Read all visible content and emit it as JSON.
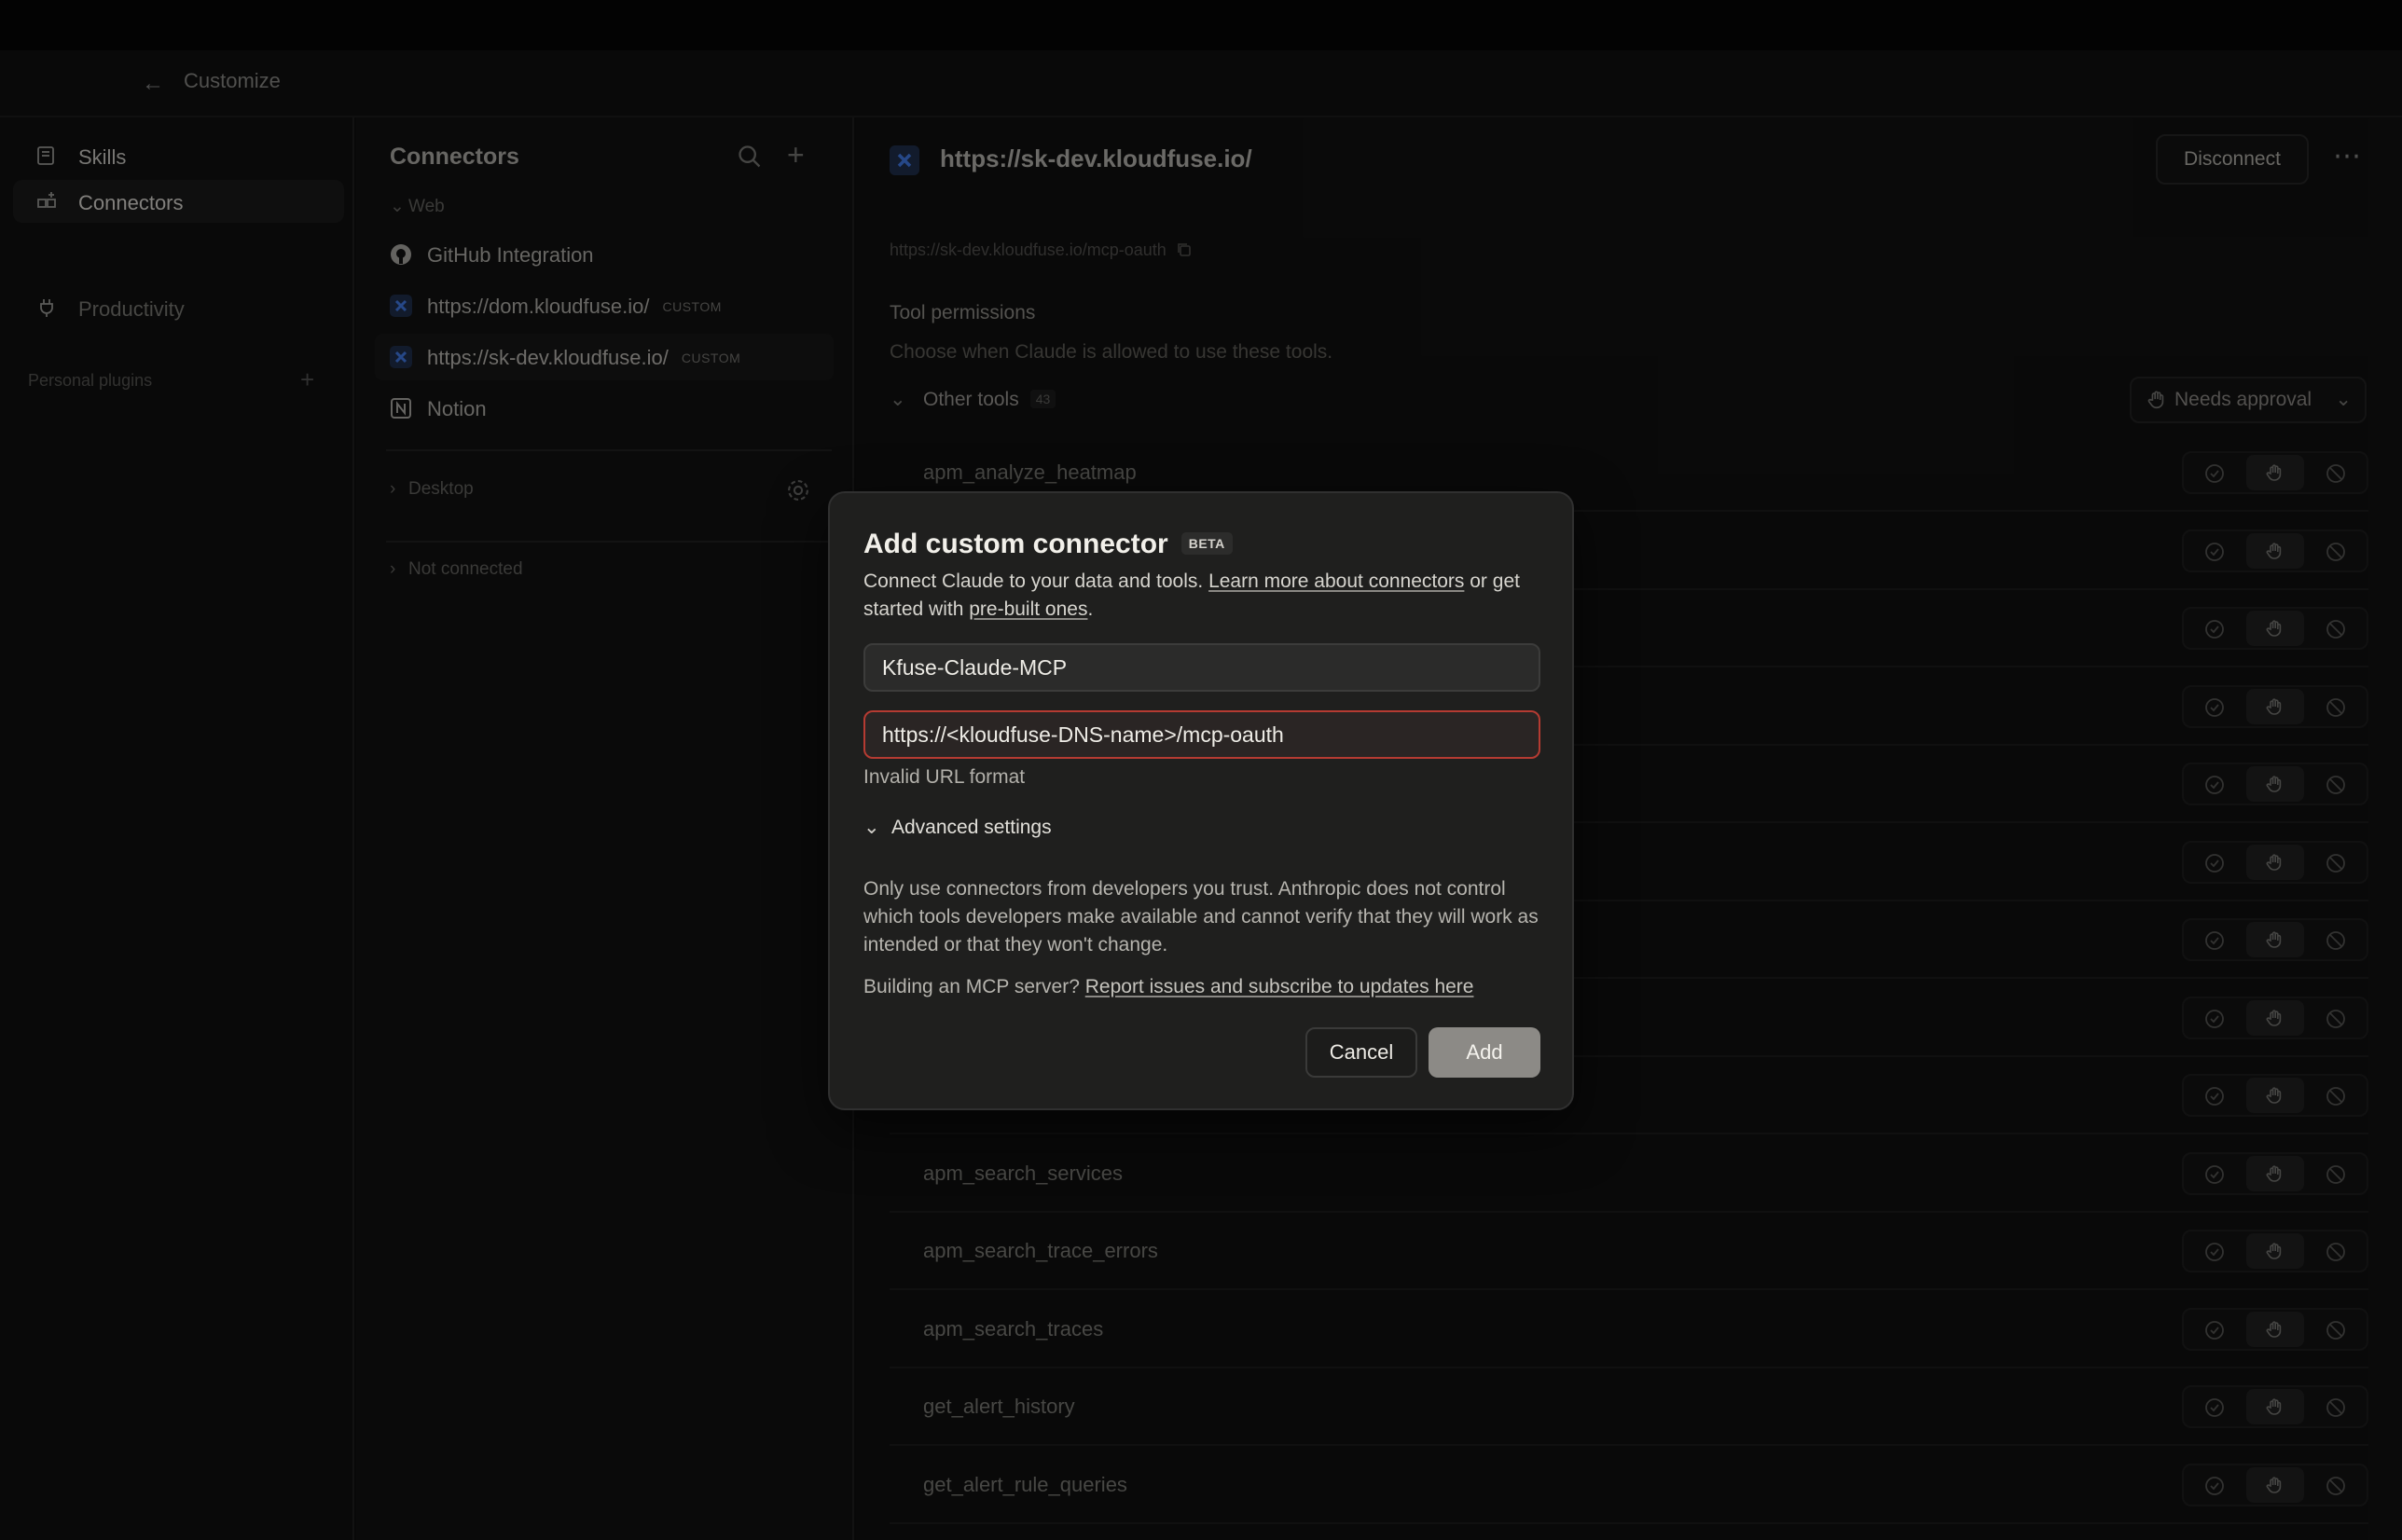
{
  "header": {
    "back_label": "Customize"
  },
  "sidebar": {
    "items": [
      {
        "label": "Skills",
        "icon": "book-icon"
      },
      {
        "label": "Connectors",
        "icon": "grid-plus-icon"
      }
    ],
    "section_title": "Personal plugins",
    "plugins": [
      {
        "label": "Productivity",
        "icon": "plug-icon"
      }
    ]
  },
  "connectors": {
    "title": "Connectors",
    "groups": {
      "web": "Web",
      "desktop": "Desktop",
      "not_connected": "Not connected"
    },
    "items": [
      {
        "name": "GitHub Integration",
        "tag": ""
      },
      {
        "name": "https://dom.kloudfuse.io/",
        "tag": "CUSTOM"
      },
      {
        "name": "https://sk-dev.kloudfuse.io/",
        "tag": "CUSTOM"
      },
      {
        "name": "Notion",
        "tag": ""
      }
    ]
  },
  "main": {
    "title": "https://sk-dev.kloudfuse.io/",
    "disconnect_label": "Disconnect",
    "url": "https://sk-dev.kloudfuse.io/mcp-oauth",
    "tool_permissions_title": "Tool permissions",
    "tool_permissions_desc": "Choose when Claude is allowed to use these tools.",
    "other_tools_label": "Other tools",
    "other_tools_count": "43",
    "approval_label": "Needs approval",
    "tools": [
      "apm_analyze_heatmap",
      "",
      "",
      "",
      "",
      "",
      "",
      "",
      "",
      "apm_search_services",
      "apm_search_trace_errors",
      "apm_search_traces",
      "get_alert_history",
      "get_alert_rule_queries"
    ]
  },
  "modal": {
    "title": "Add custom connector",
    "badge": "BETA",
    "desc_pre": "Connect Claude to your data and tools. ",
    "desc_link1": "Learn more about connectors",
    "desc_mid": " or get started with ",
    "desc_link2": "pre-built ones",
    "desc_end": ".",
    "name_value": "Kfuse-Claude-MCP",
    "url_value": "https://<kloudfuse-DNS-name>/mcp-oauth",
    "error_text": "Invalid URL format",
    "advanced_label": "Advanced settings",
    "warning": "Only use connectors from developers you trust. Anthropic does not control which tools developers make available and cannot verify that they will work as intended or that they won't change.",
    "build_pre": "Building an MCP server? ",
    "build_link": "Report issues and subscribe to updates here",
    "cancel_label": "Cancel",
    "add_label": "Add"
  },
  "colors": {
    "error_border": "#b53b32",
    "accent_blue": "#3b6fd1"
  }
}
